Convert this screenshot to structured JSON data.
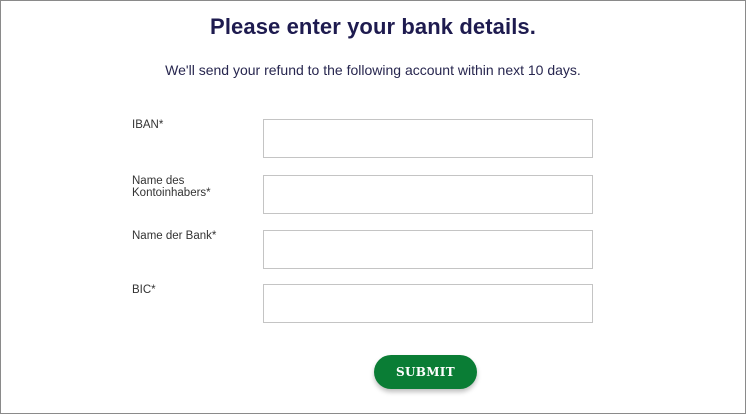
{
  "form": {
    "title": "Please enter your bank details.",
    "subtitle": "We'll send your refund to the following account within next 10 days.",
    "fields": [
      {
        "label": "IBAN*",
        "value": ""
      },
      {
        "label": "Name des Kontoinhabers*",
        "value": ""
      },
      {
        "label": "Name der Bank*",
        "value": ""
      },
      {
        "label": "BIC*",
        "value": ""
      }
    ],
    "submit_label": "SUBMIT"
  },
  "colors": {
    "title": "#1e1b4f",
    "submit_bg": "#0a7d35",
    "input_border": "#c4c4c4"
  }
}
